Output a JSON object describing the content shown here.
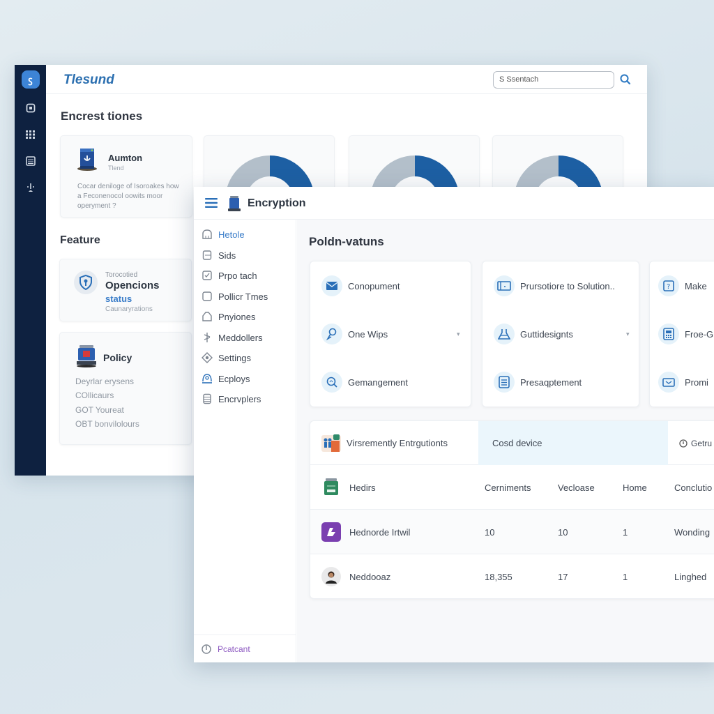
{
  "back_window": {
    "brand": "Tlesund",
    "search": {
      "placeholder": "S Ssentach"
    },
    "title": "Encrest tiones",
    "card_automation": {
      "title": "Aumton",
      "subtitle": "Tlend",
      "description": "Cocar deniloge of Isoroakes how a Feconenocol oowits moor operyment ?"
    },
    "donuts": [
      {
        "filled_fraction": 0.5,
        "color": "#1d5fa3"
      },
      {
        "filled_fraction": 0.5,
        "color": "#1d5fa3"
      },
      {
        "filled_fraction": 0.5,
        "color": "#1d5fa3"
      }
    ],
    "feature_title": "Feature",
    "card_feature": {
      "kicker": "Torocotied",
      "title": "Opencions",
      "status": "status",
      "subtitle": "Caunaryrations"
    },
    "card_policy": {
      "title": "Policy",
      "lines": [
        "Deyrlar erysens",
        "COllicaurs",
        "GOT Youreat",
        "OBT bonvilolours"
      ]
    }
  },
  "front_window": {
    "title": "Encryption",
    "nav": [
      {
        "label": "Hetole",
        "icon": "home-icon",
        "active": true
      },
      {
        "label": "Sids",
        "icon": "document-icon"
      },
      {
        "label": "Prpo tach",
        "icon": "checkbox-icon"
      },
      {
        "label": "Pollicr Tmes",
        "icon": "square-icon"
      },
      {
        "label": "Pnyiones",
        "icon": "tag-icon"
      },
      {
        "label": "Meddollers",
        "icon": "connector-icon"
      },
      {
        "label": "Settings",
        "icon": "settings-icon"
      },
      {
        "label": "Ecploys",
        "icon": "user-icon"
      },
      {
        "label": "Encrvplers",
        "icon": "database-icon"
      }
    ],
    "nav_footer": "Pcatcant",
    "main_title": "Poldn-vatuns",
    "option_cards": [
      {
        "items": [
          {
            "label": "Conopument",
            "icon": "mail-icon"
          },
          {
            "label": "One Wips",
            "icon": "pin-icon",
            "dropdown": true
          },
          {
            "label": "Gemangement",
            "icon": "search-icon"
          }
        ]
      },
      {
        "items": [
          {
            "label": "Prursotiore to Solution..",
            "icon": "window-icon"
          },
          {
            "label": "Guttidesignts",
            "icon": "flask-icon",
            "dropdown": true
          },
          {
            "label": "Presaqptement",
            "icon": "list-icon"
          }
        ]
      },
      {
        "items": [
          {
            "label": "Make",
            "icon": "help-icon"
          },
          {
            "label": "Froe-G",
            "icon": "calculator-icon"
          },
          {
            "label": "Promi",
            "icon": "card-icon"
          }
        ]
      }
    ],
    "table": {
      "tabs": [
        "Virsremently Entrgutionts",
        "Cosd device",
        "Getru"
      ],
      "header": [
        "Hedirs",
        "Cerniments",
        "Vecloase",
        "Home",
        "Conclutio"
      ],
      "rows": [
        [
          "Hednorde Irtwil",
          "10",
          "10",
          "1",
          "Wonding"
        ],
        [
          "Neddooaz",
          "18,355",
          "17",
          "1",
          "Linghed"
        ]
      ]
    }
  }
}
